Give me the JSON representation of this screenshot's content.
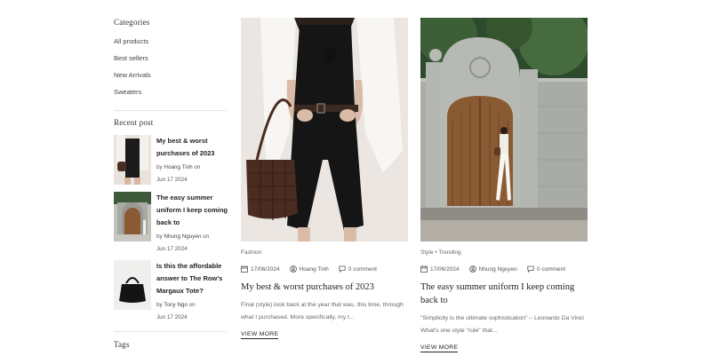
{
  "sidebar": {
    "categories_heading": "Categories",
    "categories": [
      "All products",
      "Best sellers",
      "New Arrivals",
      "Sweaters"
    ],
    "recent_heading": "Recent post",
    "recent_posts": [
      {
        "title": "My best & worst purchases of 2023",
        "by": "by",
        "author": "Hoang Tinh",
        "on": "on",
        "date": "Jun 17 2024"
      },
      {
        "title": "The easy summer uniform I keep coming back to",
        "by": "by",
        "author": "Nhung Nguyen",
        "on": "on",
        "date": "Jun 17 2024"
      },
      {
        "title": "Is this the affordable answer to The Row's Margaux Tote?",
        "by": "by",
        "author": "Tony Ngo",
        "on": "on",
        "date": "Jun 17 2024"
      }
    ],
    "tags_heading": "Tags"
  },
  "cards": [
    {
      "tags": "Fashion",
      "date": "17/06/2024",
      "author": "Hoang Tinh",
      "comments": "0 comment",
      "title": "My best & worst purchases of 2023",
      "excerpt": "Final (style) look back at the year that was, this time, through what I purchased. More specifically, my t...",
      "cta": "VIEW MORE"
    },
    {
      "tags": "Style  •  Trending",
      "date": "17/06/2024",
      "author": "Nhung Nguyen",
      "comments": "0 comment",
      "title": "The easy summer uniform I keep coming back to",
      "excerpt": "\"Simplicity is the ultimate sophistication\" – Leonardo Da Vinci What's one style \"rule\" that...",
      "cta": "VIEW MORE"
    }
  ],
  "icons": [
    "calendar-icon",
    "user-icon",
    "comment-icon"
  ]
}
